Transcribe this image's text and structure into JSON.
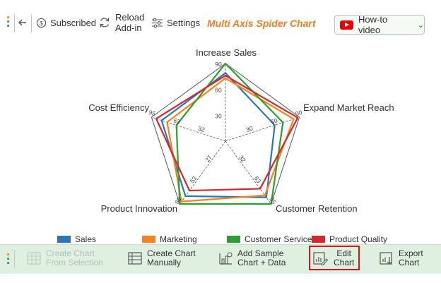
{
  "toolbar": {
    "subscribed_label": "Subscribed",
    "reload_label_line1": "Reload",
    "reload_label_line2": "Add-in",
    "settings_label": "Settings",
    "app_title": "Multi Axis Spider Chart",
    "howto_label": "How-to video"
  },
  "chart_data": {
    "type": "radar",
    "axes": [
      "Increase Sales",
      "Expand Market Reach",
      "Customer Retention",
      "Product Innovation",
      "Cost Efficiency"
    ],
    "tick_labels": [
      [
        "30",
        "60",
        "90"
      ],
      [
        "30",
        "60",
        "90"
      ],
      [
        "32",
        "63",
        "95"
      ],
      [
        "27",
        "53",
        "80"
      ],
      [
        "32",
        "63",
        "95"
      ]
    ],
    "axis_ranges": [
      [
        0,
        90
      ],
      [
        0,
        90
      ],
      [
        0,
        95
      ],
      [
        0,
        80
      ],
      [
        0,
        95
      ]
    ],
    "series": [
      {
        "name": "Sales",
        "color": "#2e75b6",
        "values": [
          79,
          60,
          85,
          70,
          82
        ]
      },
      {
        "name": "Marketing",
        "color": "#f5821f",
        "values": [
          73,
          83,
          82,
          77,
          75
        ]
      },
      {
        "name": "Customer Service",
        "color": "#2e9e2e",
        "values": [
          90,
          70,
          95,
          80,
          63
        ]
      },
      {
        "name": "Product Quality",
        "color": "#d9262b",
        "values": [
          76,
          88,
          72,
          63,
          89
        ]
      }
    ],
    "legend_position": "bottom"
  },
  "bottom": {
    "create_selection_line1": "Create Chart",
    "create_selection_line2": "From Selection",
    "create_manual_line1": "Create Chart",
    "create_manual_line2": "Manually",
    "sample_line1": "Add Sample",
    "sample_line2": "Chart + Data",
    "edit_line1": "Edit",
    "edit_line2": "Chart",
    "export_line1": "Export",
    "export_line2": "Chart"
  }
}
